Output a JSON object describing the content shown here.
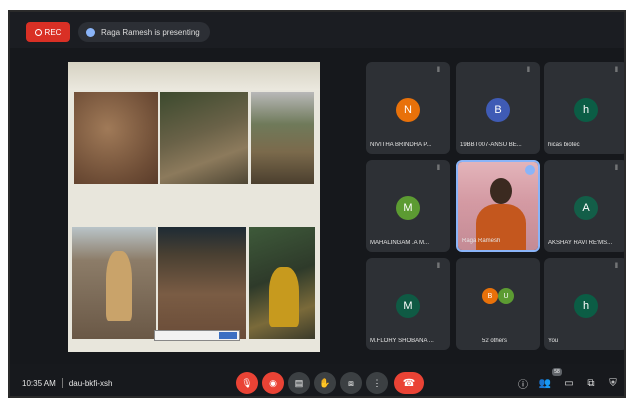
{
  "top_bar": {
    "rec_label": "REC",
    "presenting_text": "Raga Ramesh is presenting"
  },
  "presentation": {
    "caption_text": ""
  },
  "participants": [
    {
      "initial": "N",
      "name": "NIVITHA BRINDHA P...",
      "color": "#e8710a"
    },
    {
      "initial": "B",
      "name": "19BBT007-ANSU BE...",
      "color": "#3f5bb5"
    },
    {
      "initial": "h",
      "name": "hicas biotec",
      "color": "#0b5d45"
    },
    {
      "initial": "M",
      "name": "MAHALINGAM .A M...",
      "color": "#5c9b32"
    },
    {
      "initial": "",
      "name": "Raga Ramesh",
      "color": ""
    },
    {
      "initial": "A",
      "name": "AKSHAY RAVI RE'MS...",
      "color": "#135e48"
    },
    {
      "initial": "M",
      "name": "M.FLORY SHOBANA ...",
      "color": "#0f5a44"
    },
    {
      "initial": "",
      "name": "52 others",
      "color": ""
    },
    {
      "initial": "h",
      "name": "You",
      "color": "#0b5d45"
    }
  ],
  "others_tile": {
    "avatar_1": "B",
    "avatar_2": "U",
    "avatar_1_color": "#e8710a",
    "avatar_2_color": "#5c9b32"
  },
  "bottom_bar": {
    "time": "10:35 AM",
    "meeting_code": "dau-bkfi-xsh",
    "participant_count": "58"
  },
  "colors": {
    "end_call": "#ea4335",
    "accent": "#8ab4f8"
  }
}
